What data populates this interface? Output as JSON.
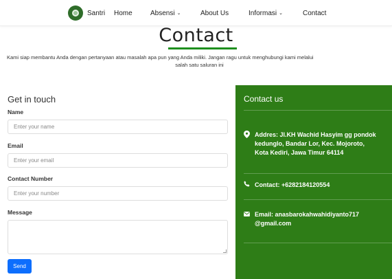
{
  "nav": {
    "brand": "Santri",
    "items": {
      "home": "Home",
      "absensi": "Absensi",
      "about": "About Us",
      "informasi": "Informasi",
      "contact": "Contact"
    }
  },
  "header": {
    "title": "Contact",
    "intro_line1": "Kami siap membantu Anda dengan pertanyaan atau masalah apa pun yang Anda miliki. Jangan ragu untuk menghubungi kami melalui",
    "intro_line2": "salah satu saluran ini"
  },
  "form": {
    "heading": "Get in touch",
    "name_label": "Name",
    "name_placeholder": "Enter your name",
    "email_label": "Email",
    "email_placeholder": "Enter your email",
    "contact_label": "Contact Number",
    "contact_placeholder": "Enter your number",
    "message_label": "Message",
    "send_label": "Send"
  },
  "contact_panel": {
    "title": "Contact us",
    "address_line1": "Addres: Jl.KH Wachid Hasyim gg pondok",
    "address_line2": "kedunglo, Bandar Lor, Kec. Mojoroto,",
    "address_line3": "Kota Kediri, Jawa Timur 64114",
    "phone": "Contact: +6282184120554",
    "email_line1": "Email: anasbarokahwahidiyanto717",
    "email_line2": "@gmail.com"
  },
  "colors": {
    "accent_green": "#2e7d17",
    "button_blue": "#0d6efd",
    "title_underline": "#1e8f1e"
  }
}
